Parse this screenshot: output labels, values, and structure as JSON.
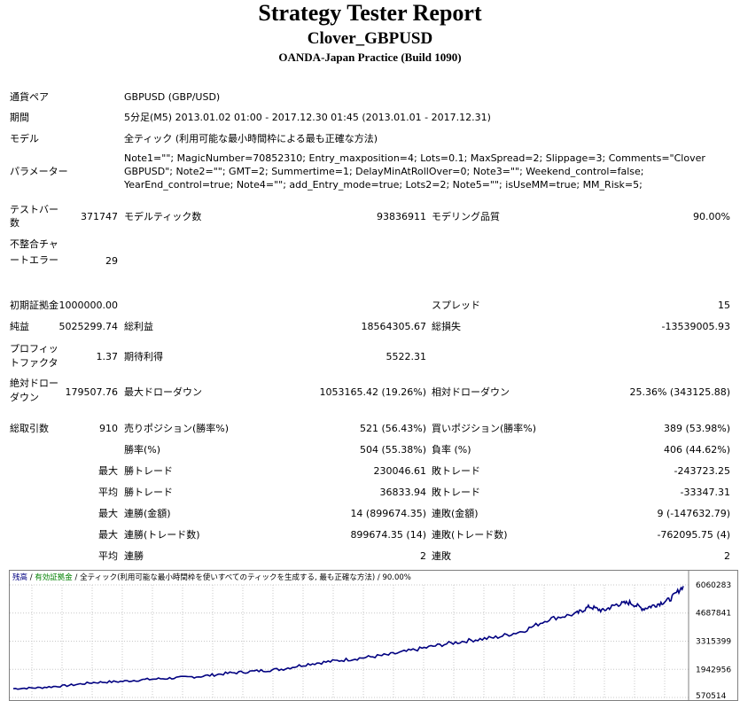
{
  "header": {
    "title": "Strategy Tester Report",
    "subtitle": "Clover_GBPUSD",
    "server": "OANDA-Japan Practice (Build 1090)"
  },
  "info": {
    "symbol_label": "通貨ペア",
    "symbol_value": "GBPUSD (GBP/USD)",
    "period_label": "期間",
    "period_value": "5分足(M5) 2013.01.02 01:00 - 2017.12.30 01:45 (2013.01.01 - 2017.12.31)",
    "model_label": "モデル",
    "model_value": "全ティック (利用可能な最小時間枠による最も正確な方法)",
    "params_label": "パラメーター",
    "params_value": "Note1=\"\"; MagicNumber=70852310; Entry_maxposition=4; Lots=0.1; MaxSpread=2; Slippage=3; Comments=\"Clover GBPUSD\"; Note2=\"\"; GMT=2; Summertime=1; DelayMinAtRollOver=0; Note3=\"\"; Weekend_control=false; YearEnd_control=true; Note4=\"\"; add_Entry_mode=true; Lots2=2; Note5=\"\"; isUseMM=true; MM_Risk=5;"
  },
  "stats": {
    "bars_label": "テストバー数",
    "bars_value": "371747",
    "ticks_label": "モデルティック数",
    "ticks_value": "93836911",
    "quality_label": "モデリング品質",
    "quality_value": "90.00%",
    "mismatch_label": "不整合チャートエラー",
    "mismatch_value": "29",
    "deposit_label": "初期証拠金",
    "deposit_value": "1000000.00",
    "spread_label": "スプレッド",
    "spread_value": "15",
    "net_label": "純益",
    "net_value": "5025299.74",
    "gross_profit_label": "総利益",
    "gross_profit_value": "18564305.67",
    "gross_loss_label": "総損失",
    "gross_loss_value": "-13539005.93",
    "pf_label": "プロフィットファクタ",
    "pf_value": "1.37",
    "payoff_label": "期待利得",
    "payoff_value": "5522.31",
    "abs_dd_label": "絶対ドローダウン",
    "abs_dd_value": "179507.76",
    "max_dd_label": "最大ドローダウン",
    "max_dd_value": "1053165.42 (19.26%)",
    "rel_dd_label": "相対ドローダウン",
    "rel_dd_value": "25.36% (343125.88)",
    "trades_label": "総取引数",
    "trades_value": "910",
    "short_label": "売りポジション(勝率%)",
    "short_value": "521 (56.43%)",
    "long_label": "買いポジション(勝率%)",
    "long_value": "389 (53.98%)",
    "win_label": "勝率(%)",
    "win_value": "504 (55.38%)",
    "loss_label": "負率 (%)",
    "loss_value": "406 (44.62%)",
    "max_word": "最大",
    "avg_word": "平均",
    "largest_win_label": "勝トレード",
    "largest_win_value": "230046.61",
    "largest_loss_label": "敗トレード",
    "largest_loss_value": "-243723.25",
    "avg_win_label": "勝トレード",
    "avg_win_value": "36833.94",
    "avg_loss_label": "敗トレード",
    "avg_loss_value": "-33347.31",
    "max_consec_wins_label": "連勝(金額)",
    "max_consec_wins_value": "14 (899674.35)",
    "max_consec_losses_label": "連敗(金額)",
    "max_consec_losses_value": "9 (-147632.79)",
    "max_consec_profit_label": "連勝(トレード数)",
    "max_consec_profit_value": "899674.35 (14)",
    "max_consec_loss_label": "連敗(トレード数)",
    "max_consec_loss_value": "-762095.75 (4)",
    "avg_consec_wins_label": "連勝",
    "avg_consec_wins_value": "2",
    "avg_consec_losses_label": "連敗",
    "avg_consec_losses_value": "2"
  },
  "chart_legend": {
    "balance": "残高",
    "sep1": " / ",
    "equity": "有効証拠金",
    "sep2": " / ",
    "model": "全ティック(利用可能な最小時間枠を使いすべてのティックを生成する, 最も正確な方法)",
    "sep3": " / ",
    "quality": "90.00%"
  },
  "chart_data": {
    "type": "line",
    "title": "",
    "xlabel": "",
    "ylabel": "",
    "yticks": [
      "6060283",
      "4687841",
      "3315399",
      "1942956",
      "570514"
    ],
    "ylim": [
      570514,
      6060283
    ],
    "colors": {
      "balance": "#000080"
    },
    "series": [
      {
        "name": "残高",
        "x": [
          0,
          4,
          8,
          12,
          16,
          20,
          24,
          28,
          32,
          36,
          40,
          44,
          48,
          52,
          56,
          60,
          64,
          68,
          72,
          76,
          80,
          84,
          86,
          88,
          90,
          92,
          94,
          96,
          98,
          100
        ],
        "values": [
          1000000,
          1050000,
          1150000,
          1300000,
          1350000,
          1450000,
          1520000,
          1600000,
          1750000,
          1850000,
          1950000,
          2200000,
          2350000,
          2500000,
          2650000,
          2900000,
          3150000,
          3350000,
          3500000,
          3800000,
          4400000,
          4650000,
          5000000,
          4800000,
          5100000,
          5200000,
          4900000,
          5100000,
          5350000,
          6000000
        ]
      }
    ]
  }
}
